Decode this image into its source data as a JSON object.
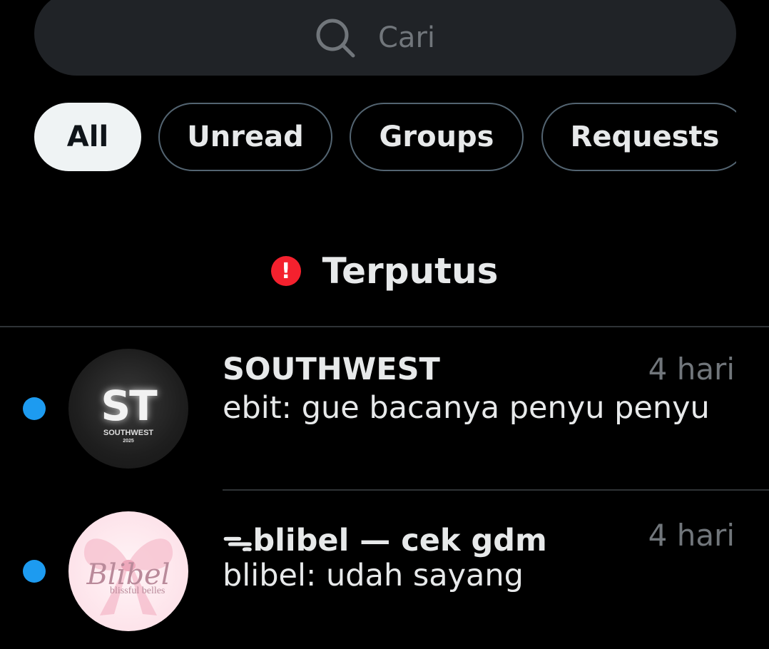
{
  "search": {
    "placeholder": "Cari"
  },
  "tabs": [
    {
      "label": "All",
      "active": true
    },
    {
      "label": "Unread",
      "active": false
    },
    {
      "label": "Groups",
      "active": false
    },
    {
      "label": "Requests",
      "active": false
    }
  ],
  "status": {
    "icon": "alert-icon",
    "icon_glyph": "!",
    "text": "Terputus",
    "color": "#f4212e"
  },
  "conversations": [
    {
      "name": "SOUTHWEST",
      "time": "4 hari",
      "preview": "ebit: gue bacanya penyu penyu",
      "unread": true,
      "avatar": {
        "logo_text": "ST",
        "sub_text": "SOUTHWEST",
        "sub_year": "2025"
      }
    },
    {
      "name": "ᯓblibel — cek gdm",
      "time": "4 hari",
      "preview": "blibel: udah sayang",
      "unread": true,
      "avatar": {
        "logo_text": "Blibel",
        "sub_text": "blissful belles"
      }
    }
  ],
  "colors": {
    "background": "#000000",
    "accent": "#1d9bf0",
    "text": "#e7e9ea",
    "muted": "#71767b"
  }
}
